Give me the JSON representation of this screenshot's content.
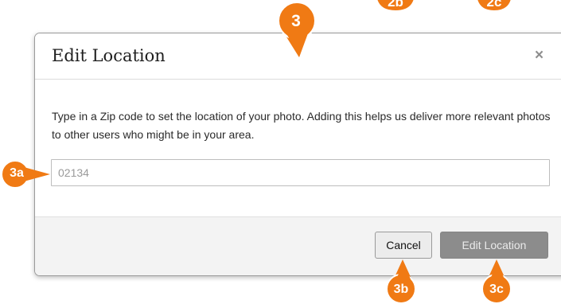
{
  "dialog": {
    "title": "Edit Location",
    "close_glyph": "×",
    "description": "Type in a Zip code to set the location of your photo. Adding this helps us deliver more relevant photos to other users who might be in your area.",
    "zip_placeholder": "02134",
    "cancel_label": "Cancel",
    "submit_label": "Edit Location"
  },
  "annotations": {
    "title_marker": "3",
    "top_marker_1": "2b",
    "top_marker_2": "2c",
    "input_marker": "3a",
    "cancel_marker": "3b",
    "submit_marker": "3c"
  },
  "colors": {
    "marker_orange": "#f07a14",
    "submit_button_bg": "#8c8c8c",
    "footer_bg": "#f3f3f3"
  }
}
